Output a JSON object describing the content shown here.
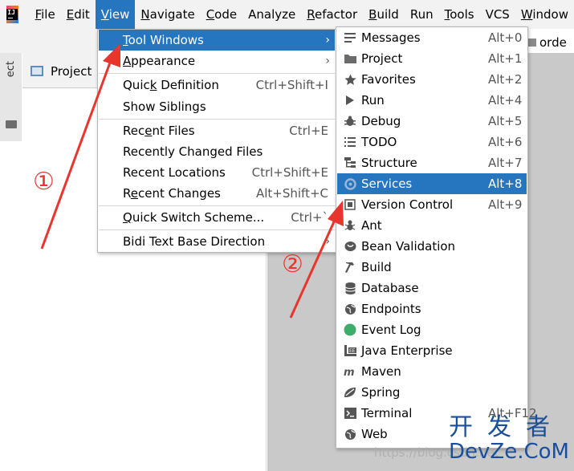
{
  "menubar": {
    "items": [
      {
        "label": "File",
        "mnemonic": "F",
        "rest": "ile"
      },
      {
        "label": "Edit",
        "mnemonic": "E",
        "rest": "dit"
      },
      {
        "label": "View",
        "mnemonic": "V",
        "rest": "iew"
      },
      {
        "label": "Navigate",
        "mnemonic": "N",
        "rest": "avigate"
      },
      {
        "label": "Code",
        "mnemonic": "C",
        "rest": "ode"
      },
      {
        "label": "Analyze",
        "mnemonic": "",
        "rest": "Analyze"
      },
      {
        "label": "Refactor",
        "mnemonic": "R",
        "rest": "efactor"
      },
      {
        "label": "Build",
        "mnemonic": "B",
        "rest": "uild"
      },
      {
        "label": "Run",
        "mnemonic": "",
        "rest": "Run"
      },
      {
        "label": "Tools",
        "mnemonic": "T",
        "rest": "ools"
      },
      {
        "label": "VCS",
        "mnemonic": "",
        "rest": "VCS"
      },
      {
        "label": "Window",
        "mnemonic": "W",
        "rest": "indow"
      }
    ]
  },
  "ide": {
    "side_label": "ect",
    "project_tab": "Project",
    "breadcrumb": "orde"
  },
  "view_menu": {
    "tool_windows": {
      "pre": "",
      "mn": "T",
      "post": "ool Windows"
    },
    "appearance": {
      "pre": "",
      "mn": "A",
      "post": "ppearance"
    },
    "quick_definition": {
      "pre": "Quic",
      "mn": "k",
      "post": " Definition",
      "shortcut": "Ctrl+Shift+I"
    },
    "show_siblings": {
      "pre": "Show Siblings",
      "mn": "",
      "post": ""
    },
    "recent_files": {
      "pre": "Rec",
      "mn": "e",
      "post": "nt Files",
      "shortcut": "Ctrl+E"
    },
    "recently_changed": {
      "pre": "Recently Changed Files",
      "mn": "",
      "post": ""
    },
    "recent_locations": {
      "pre": "Recent Locations",
      "mn": "",
      "post": "",
      "shortcut": "Ctrl+Shift+E"
    },
    "recent_changes": {
      "pre": "R",
      "mn": "e",
      "post": "cent Changes",
      "shortcut": "Alt+Shift+C"
    },
    "quick_switch": {
      "pre": "",
      "mn": "Q",
      "post": "uick Switch Scheme...",
      "shortcut": "Ctrl+`"
    },
    "bidi": {
      "pre": "Bidi Text Base Direction",
      "mn": "",
      "post": ""
    }
  },
  "tool_windows": {
    "items": [
      {
        "label": "Messages",
        "shortcut": "Alt+0",
        "icon": "messages-icon"
      },
      {
        "label": "Project",
        "shortcut": "Alt+1",
        "icon": "folder-icon"
      },
      {
        "label": "Favorites",
        "shortcut": "Alt+2",
        "icon": "star-icon"
      },
      {
        "label": "Run",
        "shortcut": "Alt+4",
        "icon": "play-icon"
      },
      {
        "label": "Debug",
        "shortcut": "Alt+5",
        "icon": "bug-icon"
      },
      {
        "label": "TODO",
        "shortcut": "Alt+6",
        "icon": "list-icon"
      },
      {
        "label": "Structure",
        "shortcut": "Alt+7",
        "icon": "structure-icon"
      },
      {
        "label": "Services",
        "shortcut": "Alt+8",
        "icon": "services-icon"
      },
      {
        "label": "Version Control",
        "shortcut": "Alt+9",
        "icon": "vcs-icon"
      },
      {
        "label": "Ant",
        "shortcut": "",
        "icon": "ant-icon"
      },
      {
        "label": "Bean Validation",
        "shortcut": "",
        "icon": "bean-icon"
      },
      {
        "label": "Build",
        "shortcut": "",
        "icon": "hammer-icon"
      },
      {
        "label": "Database",
        "shortcut": "",
        "icon": "database-icon"
      },
      {
        "label": "Endpoints",
        "shortcut": "",
        "icon": "globe-icon"
      },
      {
        "label": "Event Log",
        "shortcut": "",
        "icon": "event-log-icon"
      },
      {
        "label": "Java Enterprise",
        "shortcut": "",
        "icon": "java-ee-icon"
      },
      {
        "label": "Maven",
        "shortcut": "",
        "icon": "maven-icon"
      },
      {
        "label": "Spring",
        "shortcut": "",
        "icon": "spring-leaf-icon"
      },
      {
        "label": "Terminal",
        "shortcut": "Alt+F12",
        "icon": "terminal-icon"
      },
      {
        "label": "Web",
        "shortcut": "",
        "icon": "web-globe-icon"
      }
    ]
  },
  "annotations": {
    "step1": "①",
    "step2": "②"
  },
  "watermark": {
    "url": "https://blog.csdn.net",
    "brand_cn": "开发者",
    "brand_en": "DevZe.CoM"
  },
  "colors": {
    "accent": "#2675bf",
    "annotation": "#e8362e",
    "brand": "#1a4f9c"
  }
}
